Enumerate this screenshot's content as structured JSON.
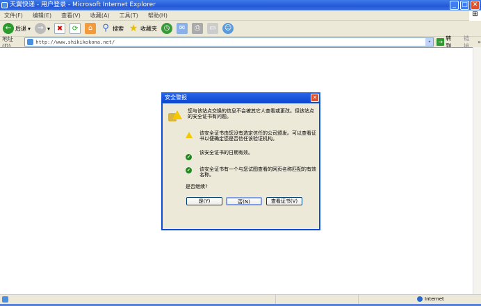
{
  "window": {
    "title": "天翼快递 - 用户登录 - Microsoft Internet Explorer"
  },
  "menu": [
    "文件(F)",
    "编辑(E)",
    "查看(V)",
    "收藏(A)",
    "工具(T)",
    "帮助(H)"
  ],
  "toolbar": {
    "back": "后退",
    "search": "搜索",
    "favorites": "收藏夹"
  },
  "address": {
    "label": "地址(D)",
    "url": "http://www.shikikokona.net/",
    "go": "转到",
    "links": "链接"
  },
  "dialog": {
    "title": "安全警报",
    "intro": "您与该站点交换的信息不会被其它人查看或更改。但该站点的安全证书有问题。",
    "items": [
      {
        "icon": "warning-icon",
        "text": "该安全证书由您没有选定信任的公司颁发。可以查看证书以便确定您是否信任该验证机构。"
      },
      {
        "icon": "check-icon",
        "text": "该安全证书的日期有效。"
      },
      {
        "icon": "check-icon",
        "text": "该安全证书有一个与您试图查看的网页名称匹配的有效名称。"
      }
    ],
    "question": "是否继续?",
    "yes": "是(Y)",
    "no": "否(N)",
    "view": "查看证书(V)"
  },
  "status": {
    "zone": "Internet"
  }
}
